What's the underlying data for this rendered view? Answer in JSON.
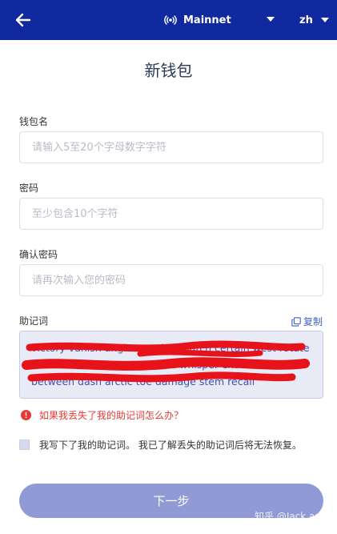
{
  "header": {
    "network_label": "Mainnet",
    "language_label": "zh"
  },
  "page": {
    "title": "新钱包"
  },
  "form": {
    "wallet_name": {
      "label": "钱包名",
      "placeholder": "请输入5至20个字母数字字符",
      "value": ""
    },
    "password": {
      "label": "密码",
      "placeholder": "至少包含10个字符",
      "value": ""
    },
    "confirm_password": {
      "label": "确认密码",
      "placeholder": "请再次输入您的密码",
      "value": ""
    },
    "mnemonic": {
      "label": "助记词",
      "copy_label": "复制",
      "text": "victory vanish angle crumble match certain west rotate h... ...e amount smooth build whisper exotic weird between dash arctic toe damage stem recall"
    },
    "warning_link": "如果我丢失了我的助记词怎么办？",
    "confirm_text": "我写下了我的助记词。 我已了解丢失的助记词后将无法恢复。",
    "confirm_checked": false,
    "next_label": "下一步"
  },
  "watermark": "知乎 @Jack an",
  "colors": {
    "header_bg": "#10299e",
    "accent": "#3e63c6",
    "button_bg": "#909bd6",
    "mnemonic_bg": "#e8eaf6",
    "scribble": "#e8121a",
    "warning": "#e53935"
  }
}
